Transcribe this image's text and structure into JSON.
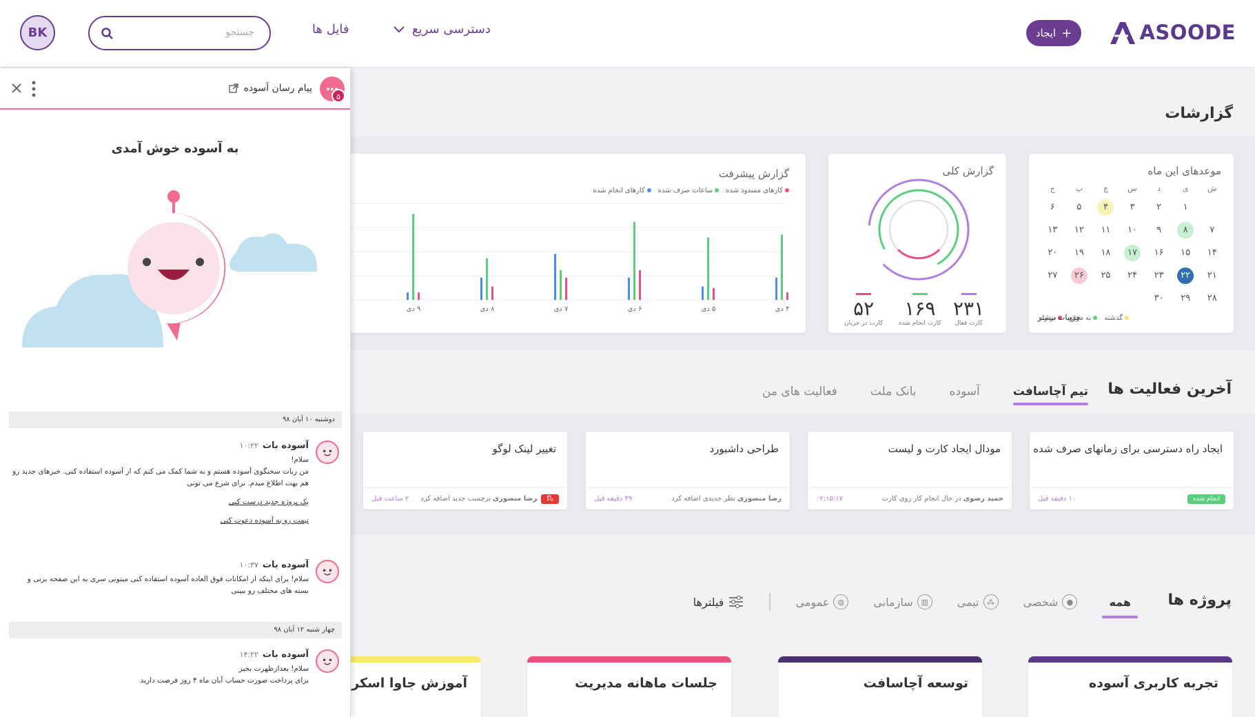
{
  "header": {
    "logo": "ASOODE",
    "create_label": "ایجاد",
    "quick_access": "دسترسی سریع",
    "files": "فایل ها",
    "search_placeholder": "جستجو",
    "avatar_initials": "BK"
  },
  "reports": {
    "title": "گزارشات",
    "calendar": {
      "title": "موعدهای این ماه",
      "weekdays": [
        "ش",
        "ی",
        "د",
        "س",
        "چ",
        "پ",
        "ج"
      ],
      "rows": [
        [
          "",
          "۱",
          "۲",
          "۳",
          "۴",
          "۵",
          "۶"
        ],
        [
          "۷",
          "۸",
          "۹",
          "۱۰",
          "۱۱",
          "۱۲",
          "۱۳"
        ],
        [
          "۱۴",
          "۱۵",
          "۱۶",
          "۱۷",
          "۱۸",
          "۱۹",
          "۲۰"
        ],
        [
          "۲۱",
          "۲۲",
          "۲۳",
          "۲۴",
          "۲۵",
          "۲۶",
          "۲۷"
        ],
        [
          "۲۸",
          "۲۹",
          "۳۰",
          "",
          "",
          "",
          ""
        ]
      ],
      "legend": [
        "گذشته",
        "به موقع",
        "در راه"
      ],
      "more": "جزییات بیشتر"
    },
    "overview": {
      "title": "گزارش کلی",
      "stats": [
        {
          "value": "۲۳۱",
          "label": "کارت فعال",
          "color": "#b07ee0"
        },
        {
          "value": "۱۶۹",
          "label": "کارت انجام شده",
          "color": "#5ccf7e"
        },
        {
          "value": "۵۲",
          "label": "کارت در جریان",
          "color": "#e8517f"
        }
      ]
    },
    "progress": {
      "title": "گزارش پیشرفت",
      "legend": [
        "کارهای مسدود شده",
        "ساعات صرف شده",
        "کارهای انجام شده"
      ]
    }
  },
  "chart_data": {
    "type": "bar",
    "title": "گزارش پیشرفت",
    "categories": [
      "۴ دی",
      "۵ دی",
      "۶ دی",
      "۷ دی",
      "۸ دی",
      "۹ دی"
    ],
    "series": [
      {
        "name": "کارهای انجام شده",
        "color": "#4a90e2",
        "values": [
          30,
          18,
          30,
          62,
          30,
          10
        ]
      },
      {
        "name": "ساعات صرف شده",
        "color": "#5ccf7e",
        "values": [
          88,
          84,
          105,
          40,
          56,
          116
        ]
      },
      {
        "name": "کارهای مسدود شده",
        "color": "#e8517f",
        "values": [
          10,
          16,
          40,
          30,
          18,
          10
        ]
      }
    ],
    "ylim": [
      0,
      130
    ],
    "grid": true,
    "legend_position": "top-right"
  },
  "activities": {
    "title": "آخرین فعالیت ها",
    "tabs": [
      "تیم آچاسافت",
      "آسوده",
      "بانک ملت",
      "فعالیت های من"
    ],
    "cards": [
      {
        "title": "ایجاد راه دسترسی برای زمانهای صرف شده",
        "badge": "انجام شده",
        "badge_color": "#5ccf7e",
        "user": "",
        "action": "",
        "time": "۱۰ دقیقه قبل"
      },
      {
        "title": "مودال ایجاد کارت و لیست",
        "badge": "",
        "badge_color": "",
        "user": "حمید رضوی",
        "action": "در حال انجام کار روی کارت",
        "time": "۰۲:۱۵:۱۷"
      },
      {
        "title": "طراحی داشبورد",
        "badge": "",
        "badge_color": "",
        "user": "رضا منصوری",
        "action": "نظر جدیدی اضافه کرد",
        "time": "۴۹ دقیقه قبل"
      },
      {
        "title": "تغییر لینک لوگو",
        "badge": "باگ",
        "badge_color": "#e53935",
        "user": "رضا منصوری",
        "action": "برچسب جدید اضافه کرد",
        "time": "۲ ساعت قبل"
      }
    ]
  },
  "projects": {
    "title": "پروژه ها",
    "tabs": [
      "همه",
      "شخصی",
      "تیمی",
      "سازمانی",
      "عمومی"
    ],
    "filters": "فیلترها",
    "cards": [
      {
        "title": "تجربه کاربری آسوده",
        "color": "#5b3a8e"
      },
      {
        "title": "توسعه آچاسافت",
        "color": "#4b2f70"
      },
      {
        "title": "جلسات ماهانه مدیریت",
        "color": "#e8517f"
      },
      {
        "title": "آموزش جاوا اسکریپت",
        "color": "#f5e96b"
      }
    ]
  },
  "chat": {
    "title": "پیام رسان آسوده",
    "badge": "۵",
    "welcome": "به آسوده خوش آمدی",
    "date1": "دوشنبه ۱۰ آبان ۹۸",
    "date2": "چهار شنبه ۱۲ آبان ۹۸",
    "messages": [
      {
        "name": "آسوده بات",
        "time": "۱۰:۲۲",
        "greeting": "سلام!",
        "text": "من ربات سخنگوی آسوده هستم و به شما کمک می کنم که از آسوده استفاده کنی. خبرهای جدید رو هم بهت اطلاع میدم. برای شرع می تونی",
        "link1": "یک پروژه جدید درست کنی",
        "link2": "تیمت رو به آسوده دعوت کنی"
      },
      {
        "name": "آسوده بات",
        "time": "۱۰:۳۷",
        "text": "سلام! برای اینکه از امکانات فوق العاده آسوده استفاده کنی میتونی سری به این صفحه بزنی و بسته های مختلف رو ببینی"
      },
      {
        "name": "آسوده بات",
        "time": "۱۴:۲۲",
        "greeting": "سلام! بعدازظهرت بخیر",
        "text": "برای پرداخت صورت حساب آبان ماه ۴ روز فرصت دارید"
      }
    ]
  }
}
